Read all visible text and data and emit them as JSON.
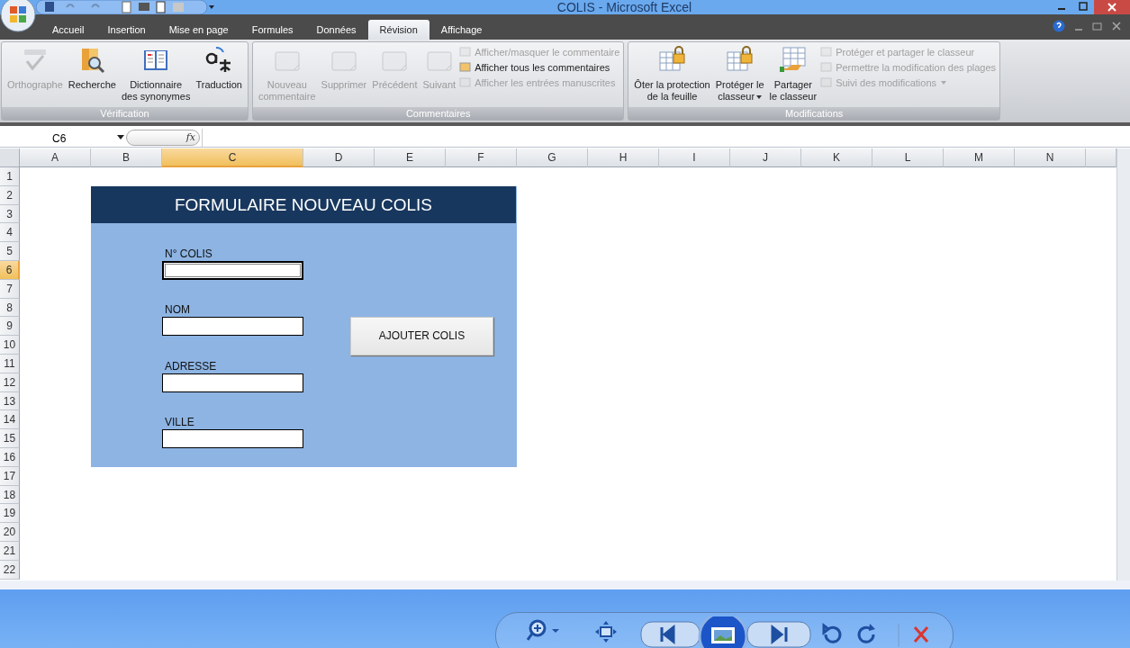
{
  "window": {
    "title": "COLIS - Microsoft Excel"
  },
  "tabs": [
    {
      "label": "Accueil",
      "selected": false
    },
    {
      "label": "Insertion",
      "selected": false
    },
    {
      "label": "Mise en page",
      "selected": false
    },
    {
      "label": "Formules",
      "selected": false
    },
    {
      "label": "Données",
      "selected": false
    },
    {
      "label": "Révision",
      "selected": true
    },
    {
      "label": "Affichage",
      "selected": false
    }
  ],
  "ribbon": [
    {
      "name": "Vérification",
      "large": [
        {
          "label": "Orthographe",
          "disabled": true
        },
        {
          "label": "Recherche",
          "disabled": false
        },
        {
          "label": "Dictionnaire\ndes synonymes",
          "disabled": false
        },
        {
          "label": "Traduction",
          "disabled": false
        }
      ]
    },
    {
      "name": "Commentaires",
      "large": [
        {
          "label": "Nouveau\ncommentaire",
          "disabled": true
        },
        {
          "label": "Supprimer",
          "disabled": true
        },
        {
          "label": "Précédent",
          "disabled": true
        },
        {
          "label": "Suivant",
          "disabled": true
        }
      ],
      "small": [
        {
          "label": "Afficher/masquer le commentaire",
          "disabled": true
        },
        {
          "label": "Afficher tous les commentaires",
          "disabled": false
        },
        {
          "label": "Afficher les entrées manuscrites",
          "disabled": true
        }
      ]
    },
    {
      "name": "Modifications",
      "large": [
        {
          "label": "Ôter la protection\nde la feuille",
          "disabled": false
        },
        {
          "label": "Protéger le\nclasseur",
          "disabled": false,
          "dropdown": true
        },
        {
          "label": "Partager\nle classeur",
          "disabled": false
        }
      ],
      "small": [
        {
          "label": "Protéger et partager le classeur",
          "disabled": true
        },
        {
          "label": "Permettre la modification des plages",
          "disabled": true
        },
        {
          "label": "Suivi des modifications",
          "disabled": true,
          "dropdown": true
        }
      ]
    }
  ],
  "formula_bar": {
    "name_box": "C6",
    "fx": "fx"
  },
  "columns": [
    {
      "label": "A",
      "selected": false
    },
    {
      "label": "B",
      "selected": false
    },
    {
      "label": "C",
      "selected": true
    },
    {
      "label": "D",
      "selected": false
    },
    {
      "label": "E",
      "selected": false
    },
    {
      "label": "F",
      "selected": false
    },
    {
      "label": "G",
      "selected": false
    },
    {
      "label": "H",
      "selected": false
    },
    {
      "label": "I",
      "selected": false
    },
    {
      "label": "J",
      "selected": false
    },
    {
      "label": "K",
      "selected": false
    },
    {
      "label": "L",
      "selected": false
    },
    {
      "label": "M",
      "selected": false
    },
    {
      "label": "N",
      "selected": false
    }
  ],
  "rows": [
    {
      "label": "1",
      "selected": false
    },
    {
      "label": "2",
      "selected": false
    },
    {
      "label": "3",
      "selected": false
    },
    {
      "label": "4",
      "selected": false
    },
    {
      "label": "5",
      "selected": false
    },
    {
      "label": "6",
      "selected": true
    },
    {
      "label": "7",
      "selected": false
    },
    {
      "label": "8",
      "selected": false
    },
    {
      "label": "9",
      "selected": false
    },
    {
      "label": "10",
      "selected": false
    },
    {
      "label": "11",
      "selected": false
    },
    {
      "label": "12",
      "selected": false
    },
    {
      "label": "13",
      "selected": false
    },
    {
      "label": "14",
      "selected": false
    },
    {
      "label": "15",
      "selected": false
    },
    {
      "label": "16",
      "selected": false
    },
    {
      "label": "17",
      "selected": false
    },
    {
      "label": "18",
      "selected": false
    },
    {
      "label": "19",
      "selected": false
    },
    {
      "label": "20",
      "selected": false
    },
    {
      "label": "21",
      "selected": false
    },
    {
      "label": "22",
      "selected": false
    }
  ],
  "form": {
    "title": "FORMULAIRE NOUVEAU COLIS",
    "fields": [
      {
        "label": "N° COLIS",
        "selected": true
      },
      {
        "label": "NOM",
        "selected": false
      },
      {
        "label": "ADRESSE",
        "selected": false
      },
      {
        "label": "VILLE",
        "selected": false
      }
    ],
    "button": "AJOUTER COLIS"
  }
}
